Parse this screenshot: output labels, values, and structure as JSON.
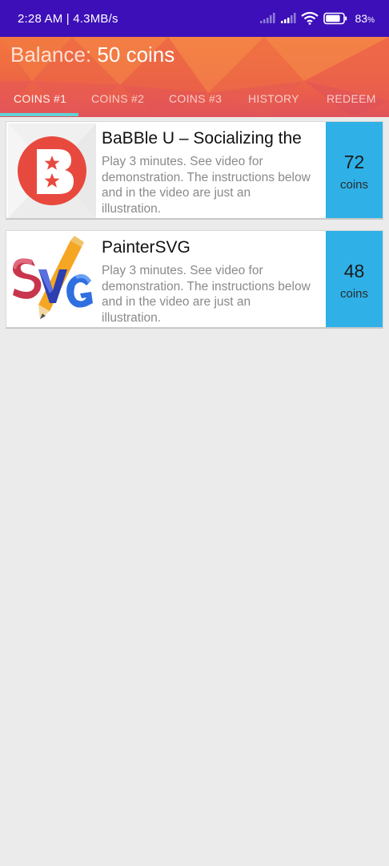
{
  "status_bar": {
    "time_speed": "2:28 AM | 4.3MB/s",
    "battery_percent": "83",
    "battery_level": 0.83
  },
  "header": {
    "balance_label": "Balance:",
    "balance_value": "50 coins"
  },
  "tabs": [
    {
      "label": "COINS #1",
      "active": true
    },
    {
      "label": "COINS #2",
      "active": false
    },
    {
      "label": "COINS #3",
      "active": false
    },
    {
      "label": "HISTORY",
      "active": false
    },
    {
      "label": "REDEEM",
      "active": false
    }
  ],
  "offers": [
    {
      "title": "BaBBle U – Socializing the",
      "description": "Play 3 minutes. See video for demonstration. The instructions below and in the video are just an illustration.",
      "reward_value": "72",
      "reward_unit": "coins",
      "icon": "babble-u-logo-icon"
    },
    {
      "title": "PainterSVG",
      "description": "Play 3 minutes. See video for demonstration. The instructions below and in the video are just an illustration.",
      "reward_value": "48",
      "reward_unit": "coins",
      "icon": "paintersvg-logo-icon"
    }
  ],
  "colors": {
    "status_bar": "#3d0fb8",
    "header_orange": "#f3763f",
    "tab_indicator": "#5ed3d8",
    "reward_blue": "#2fb1e8",
    "background": "#ebebeb"
  }
}
